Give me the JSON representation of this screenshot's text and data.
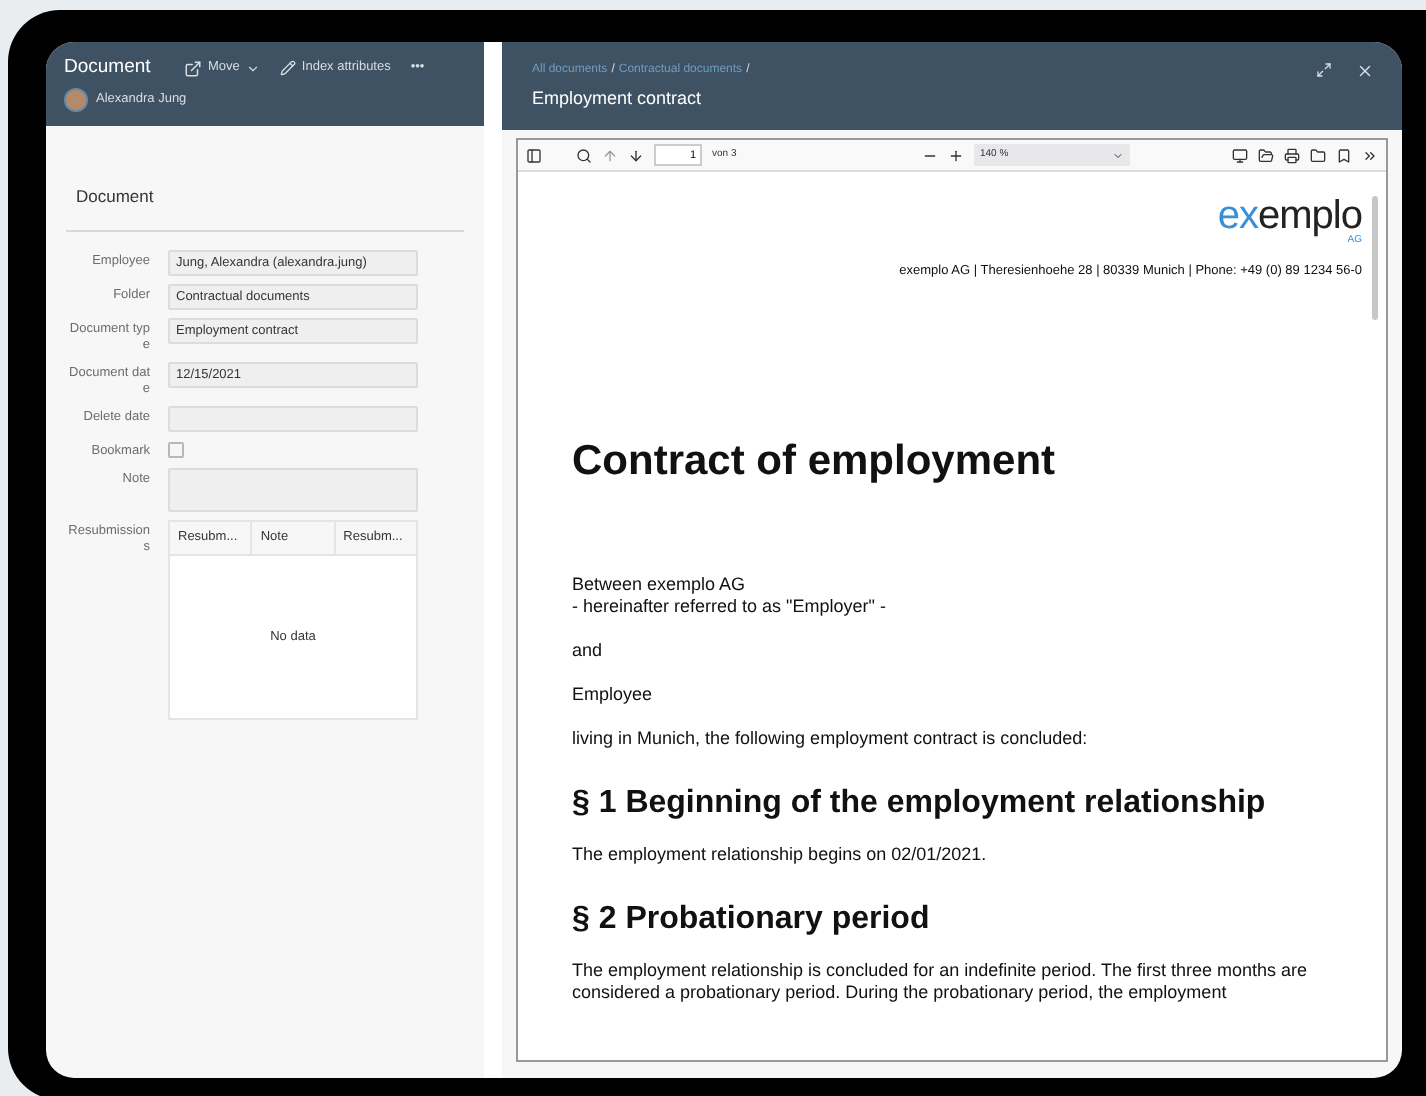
{
  "left_header": {
    "title": "Document",
    "user": "Alexandra Jung",
    "actions": [
      {
        "kind": "move",
        "label": "Move"
      },
      {
        "kind": "edit",
        "label": "Index attributes"
      },
      {
        "kind": "more",
        "label": "•••"
      }
    ]
  },
  "section_title": "Document",
  "fields": [
    {
      "kind": "text",
      "label": "Employee",
      "value": "Jung, Alexandra (alexandra.jung)"
    },
    {
      "kind": "text",
      "label": "Folder",
      "value": "Contractual documents"
    },
    {
      "kind": "text",
      "label": "Document type",
      "value": "Employment contract"
    },
    {
      "kind": "text",
      "label": "Document date",
      "value": "12/15/2021"
    },
    {
      "kind": "text",
      "label": "Delete date"
    },
    {
      "kind": "checkbox",
      "label": "Bookmark",
      "checked": false
    },
    {
      "kind": "textarea",
      "label": "Note"
    },
    {
      "kind": "table",
      "label": "Resubmissions",
      "columns": [
        "Resubm...",
        "Note",
        "Resubm..."
      ],
      "empty_text": "No data"
    }
  ],
  "right_header": {
    "breadcrumb": [
      {
        "label": "All documents",
        "separator": "/"
      },
      {
        "label": "Contractual documents",
        "separator": "/"
      }
    ],
    "title": "Employment contract"
  },
  "viewer_toolbar": {
    "page": "1",
    "page_count": "von 3",
    "zoom": "140 %"
  },
  "document": {
    "logo_prefix": "ex",
    "logo_rest": "emplo",
    "logo_sub": "AG",
    "address": "exemplo AG | Theresienhoehe 28 | 80339 Munich | Phone: +49 (0) 89 1234 56-0",
    "heading": "Contract of employment",
    "blocks": [
      {
        "kind": "lines",
        "lines": [
          "Between exemplo AG",
          "- hereinafter referred to as \"Employer\" -"
        ]
      },
      {
        "kind": "para",
        "text": "and"
      },
      {
        "kind": "para",
        "text": "Employee"
      },
      {
        "kind": "para",
        "text": "living in Munich, the following employment contract is concluded:"
      },
      {
        "kind": "h2",
        "text": "§ 1 Beginning of the employment relationship"
      },
      {
        "kind": "para",
        "text": "The employment relationship begins on 02/01/2021."
      },
      {
        "kind": "h2",
        "text": "§ 2 Probationary period"
      },
      {
        "kind": "para",
        "text": "The employment relationship is concluded for an indefinite period. The first three months are considered a probationary period. During the probationary period, the employment"
      }
    ]
  }
}
